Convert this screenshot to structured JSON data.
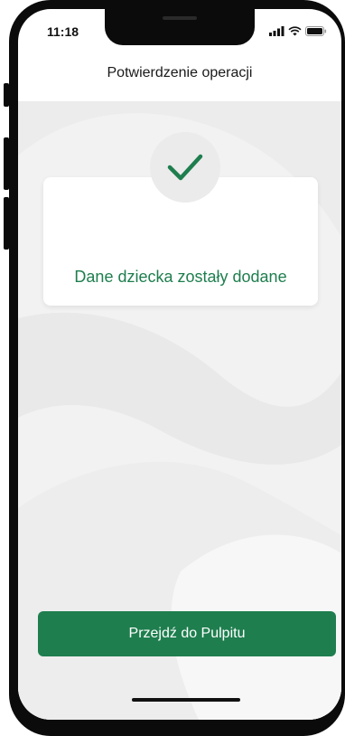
{
  "status_bar": {
    "time": "11:18",
    "icons": [
      "cellular-signal-icon",
      "wifi-icon",
      "battery-icon"
    ]
  },
  "header": {
    "title": "Potwierdzenie operacji"
  },
  "success": {
    "icon": "checkmark-icon",
    "message": "Dane dziecka zostały dodane"
  },
  "actions": {
    "primary_label": "Przejdź do Pulpitu"
  },
  "colors": {
    "accent_green": "#1e7e4e",
    "background": "#f2f2f2",
    "card": "#ffffff"
  }
}
